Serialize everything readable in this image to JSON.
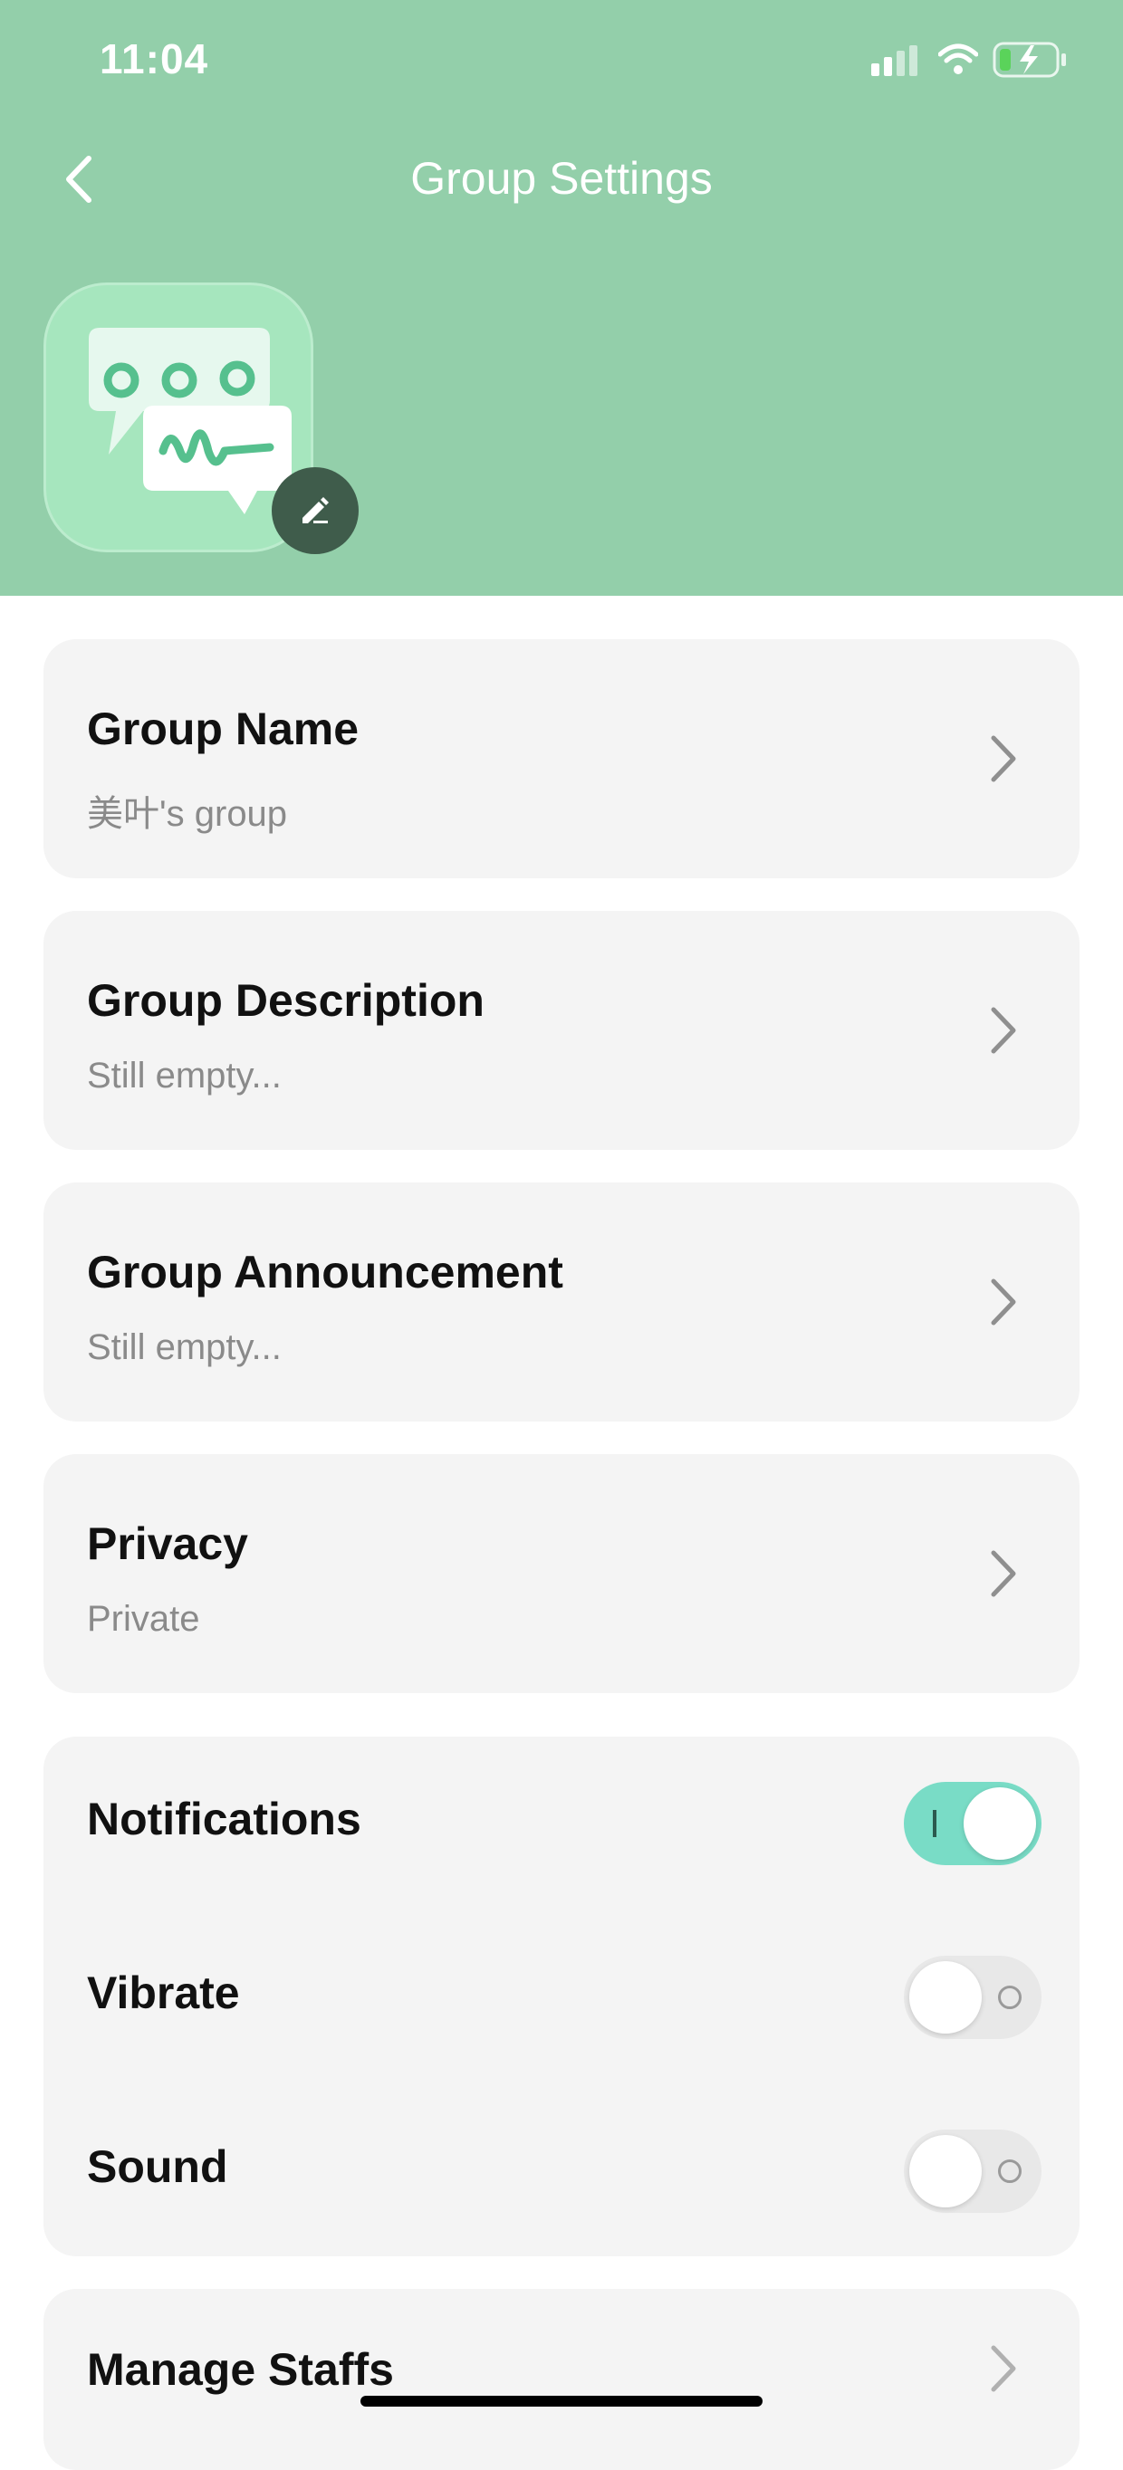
{
  "status_bar": {
    "time": "11:04"
  },
  "nav": {
    "title": "Group Settings"
  },
  "settings": [
    {
      "title": "Group Name",
      "subtitle": "美叶's group"
    },
    {
      "title": "Group Description",
      "subtitle": "Still empty..."
    },
    {
      "title": "Group Announcement",
      "subtitle": "Still empty..."
    },
    {
      "title": "Privacy",
      "subtitle": "Private"
    }
  ],
  "toggles": [
    {
      "label": "Notifications",
      "state": "on"
    },
    {
      "label": "Vibrate",
      "state": "off"
    },
    {
      "label": "Sound",
      "state": "off"
    }
  ],
  "manage": {
    "label": "Manage Staffs"
  },
  "colors": {
    "header": "#93cfaa",
    "toggle_on": "#79dcc6",
    "card": "#f4f4f4"
  }
}
